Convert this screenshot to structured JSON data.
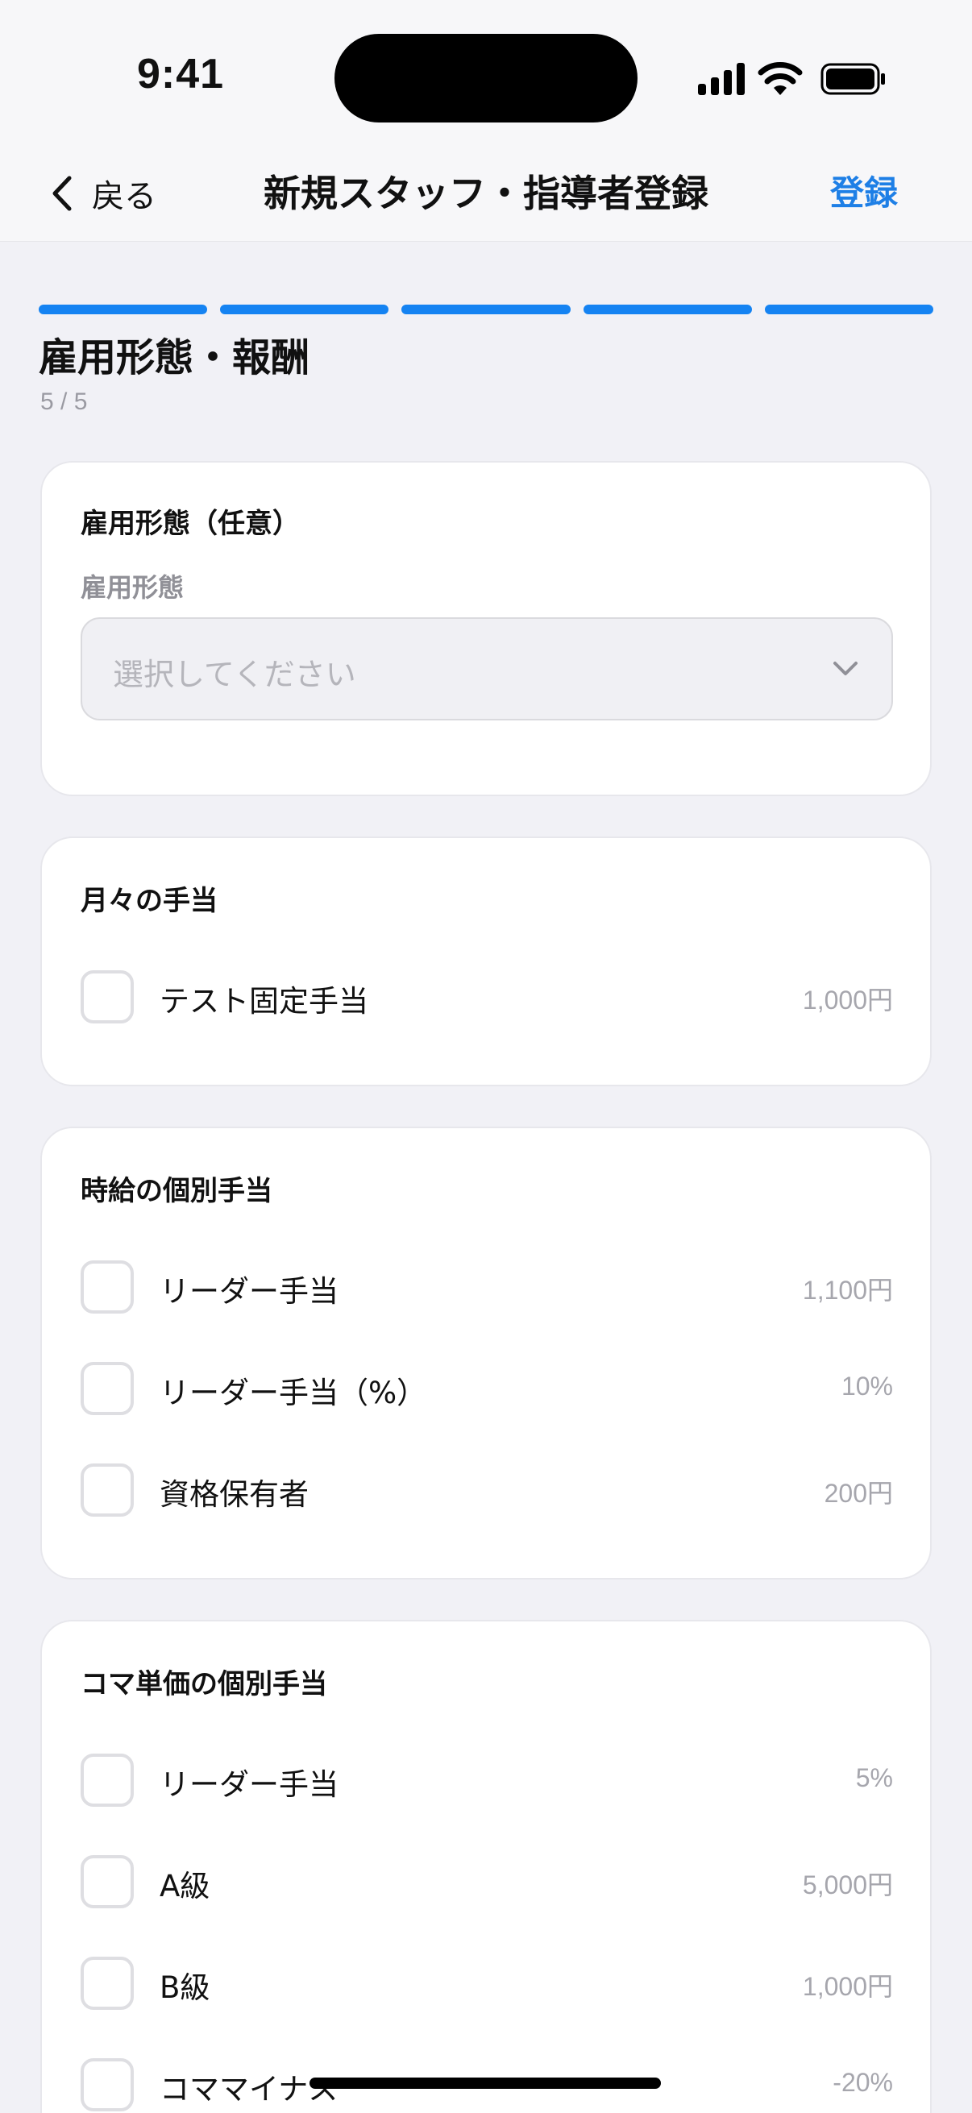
{
  "status": {
    "time": "9:41"
  },
  "nav": {
    "back_label": "戻る",
    "title": "新規スタッフ・指導者登録",
    "submit_label": "登録"
  },
  "step": {
    "title": "雇用形態・報酬",
    "count": "5 / 5",
    "total_segments": 5,
    "filled_segments": 5
  },
  "colors": {
    "accent": "#1583f2",
    "link": "#1e7fe6",
    "background": "#f1f1f6"
  },
  "employment": {
    "section_title": "雇用形態（任意）",
    "field_label": "雇用形態",
    "placeholder": "選択してください"
  },
  "monthly": {
    "section_title": "月々の手当",
    "items": [
      {
        "label": "テスト固定手当",
        "value": "1,000円",
        "checked": false
      }
    ]
  },
  "hourly": {
    "section_title": "時給の個別手当",
    "items": [
      {
        "label": "リーダー手当",
        "value": "1,100円",
        "checked": false
      },
      {
        "label": "リーダー手当（%）",
        "value": "10%",
        "checked": false
      },
      {
        "label": "資格保有者",
        "value": "200円",
        "checked": false
      }
    ]
  },
  "per_class": {
    "section_title": "コマ単価の個別手当",
    "items": [
      {
        "label": "リーダー手当",
        "value": "5%",
        "checked": false
      },
      {
        "label": "A級",
        "value": "5,000円",
        "checked": false
      },
      {
        "label": "B級",
        "value": "1,000円",
        "checked": false
      },
      {
        "label": "コママイナス",
        "value": "-20%",
        "checked": false
      }
    ]
  }
}
